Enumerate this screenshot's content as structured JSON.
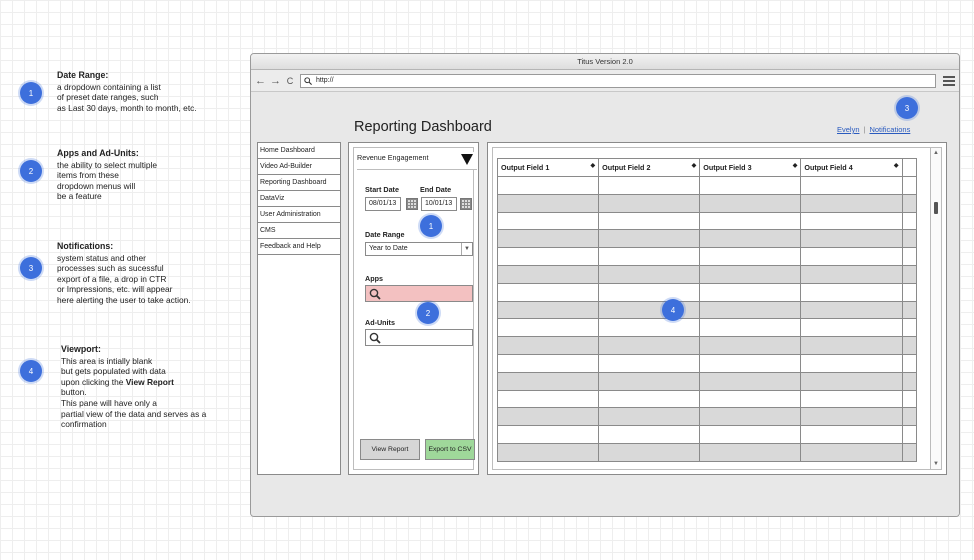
{
  "annotations": [
    {
      "number": "1",
      "title": "Date Range:",
      "lines": [
        "a dropdown containing a list",
        "of preset date ranges, such",
        "as Last 30 days, month to month, etc."
      ]
    },
    {
      "number": "2",
      "title": "Apps and Ad-Units:",
      "lines": [
        "the ability to select multiple",
        "items from these",
        "dropdown menus will",
        "be a feature"
      ]
    },
    {
      "number": "3",
      "title": "Notifications:",
      "lines": [
        "system status and other",
        "processes such as sucessful",
        "export of a file, a drop in CTR",
        "or Impressions, etc. will appear",
        "here alerting the user to take action."
      ]
    },
    {
      "number": "4",
      "title": "Viewport:",
      "lines": [
        "This area is intially blank",
        "but gets populated with data",
        "upon clicking the",
        "button.",
        "This pane will have only a",
        "partial view of the data and serves as a",
        "confirmation"
      ],
      "bold_inline": "View Report"
    }
  ],
  "window": {
    "title": "Titus Version 2.0",
    "url": "http://",
    "nav_back": "←",
    "nav_forward": "→",
    "nav_reload": "C"
  },
  "page": {
    "title": "Reporting Dashboard",
    "user_link": "Evelyn",
    "separator": "|",
    "notifications_link": "Notifications",
    "badge_notifications": "3",
    "badge_date_range": "1",
    "badge_apps": "2",
    "badge_viewport": "4"
  },
  "sidebar": {
    "items": [
      {
        "label": "Home Dashboard"
      },
      {
        "label": "Video Ad-Builder"
      },
      {
        "label": "Reporting Dashboard"
      },
      {
        "label": "DataViz"
      },
      {
        "label": "User Administration"
      },
      {
        "label": "CMS"
      },
      {
        "label": "Feedback and Help"
      }
    ]
  },
  "filters": {
    "report_type": "Revenue Engagement",
    "start_date_label": "Start Date",
    "start_date": "08/01/13",
    "end_date_label": "End Date",
    "end_date": "10/01/13",
    "date_range_label": "Date Range",
    "date_range_value": "Year to Date",
    "apps_label": "Apps",
    "ad_units_label": "Ad-Units",
    "view_report_button": "View Report",
    "export_button": "Export to CSV"
  },
  "colors": {
    "badge": "#3d6fdc",
    "apps_search_bg": "#f3c1c1",
    "export_button_bg": "#9fd89a",
    "view_report_bg": "#d6d6d6",
    "link": "#2a5bbf"
  },
  "table": {
    "columns": [
      "Output Field 1",
      "Output Field 2",
      "Output Field 3",
      "Output Field 4"
    ],
    "sort_glyph": "◆",
    "row_count": 16
  }
}
